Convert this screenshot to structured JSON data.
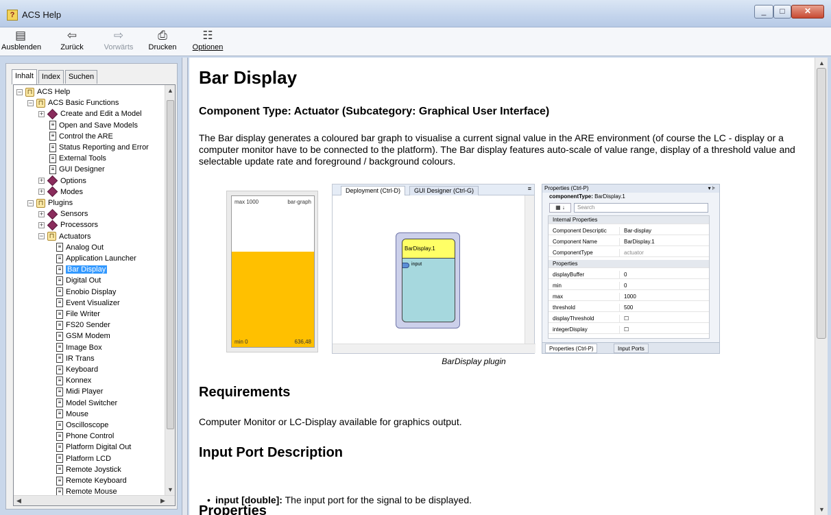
{
  "window": {
    "title": "ACS Help",
    "app_icon": "help-book-icon"
  },
  "toolbar": {
    "hide": "Ausblenden",
    "back": "Zurück",
    "forward": "Vorwärts",
    "print": "Drucken",
    "options": "Optionen"
  },
  "nav_tabs": [
    "Inhalt",
    "Index",
    "Suchen"
  ],
  "tree": [
    {
      "label": "ACS Help",
      "level": 0,
      "icon": "book",
      "expander": "−"
    },
    {
      "label": "ACS Basic Functions",
      "level": 1,
      "icon": "book",
      "expander": "−"
    },
    {
      "label": "Create and Edit a Model",
      "level": 2,
      "icon": "diamond",
      "expander": "+"
    },
    {
      "label": "Open and Save Models",
      "level": 3,
      "icon": "page"
    },
    {
      "label": "Control the ARE",
      "level": 3,
      "icon": "page"
    },
    {
      "label": "Status Reporting and Error",
      "level": 3,
      "icon": "page"
    },
    {
      "label": "External Tools",
      "level": 3,
      "icon": "page"
    },
    {
      "label": "GUI Designer",
      "level": 3,
      "icon": "page"
    },
    {
      "label": "Options",
      "level": 2,
      "icon": "diamond",
      "expander": "+"
    },
    {
      "label": "Modes",
      "level": 2,
      "icon": "diamond",
      "expander": "+"
    },
    {
      "label": "Plugins",
      "level": 1,
      "icon": "book",
      "expander": "−"
    },
    {
      "label": "Sensors",
      "level": 2,
      "icon": "diamond",
      "expander": "+"
    },
    {
      "label": "Processors",
      "level": 2,
      "icon": "diamond",
      "expander": "+"
    },
    {
      "label": "Actuators",
      "level": 2,
      "icon": "book",
      "expander": "−"
    },
    {
      "label": "Analog Out",
      "level": 4,
      "icon": "page"
    },
    {
      "label": "Application Launcher",
      "level": 4,
      "icon": "page"
    },
    {
      "label": "Bar Display",
      "level": 4,
      "icon": "page",
      "selected": true
    },
    {
      "label": "Digital Out",
      "level": 4,
      "icon": "page"
    },
    {
      "label": "Enobio Display",
      "level": 4,
      "icon": "page"
    },
    {
      "label": "Event Visualizer",
      "level": 4,
      "icon": "page"
    },
    {
      "label": "File Writer",
      "level": 4,
      "icon": "page"
    },
    {
      "label": "FS20 Sender",
      "level": 4,
      "icon": "page"
    },
    {
      "label": "GSM Modem",
      "level": 4,
      "icon": "page"
    },
    {
      "label": "Image Box",
      "level": 4,
      "icon": "page"
    },
    {
      "label": "IR Trans",
      "level": 4,
      "icon": "page"
    },
    {
      "label": "Keyboard",
      "level": 4,
      "icon": "page"
    },
    {
      "label": "Konnex",
      "level": 4,
      "icon": "page"
    },
    {
      "label": "Midi Player",
      "level": 4,
      "icon": "page"
    },
    {
      "label": "Model Switcher",
      "level": 4,
      "icon": "page"
    },
    {
      "label": "Mouse",
      "level": 4,
      "icon": "page"
    },
    {
      "label": "Oscilloscope",
      "level": 4,
      "icon": "page"
    },
    {
      "label": "Phone Control",
      "level": 4,
      "icon": "page"
    },
    {
      "label": "Platform Digital Out",
      "level": 4,
      "icon": "page"
    },
    {
      "label": "Platform LCD",
      "level": 4,
      "icon": "page"
    },
    {
      "label": "Remote Joystick",
      "level": 4,
      "icon": "page"
    },
    {
      "label": "Remote Keyboard",
      "level": 4,
      "icon": "page"
    },
    {
      "label": "Remote Mouse",
      "level": 4,
      "icon": "page"
    }
  ],
  "content": {
    "title": "Bar Display",
    "subtitle": "Component Type: Actuator (Subcategory: Graphical User Interface)",
    "description": "The Bar display generates a coloured bar graph to visualise a current signal value in the ARE environment (of course the LC - display or a computer monitor have to be connected to the platform). The Bar display features auto-scale of value range, display of a threshold value and selectable update rate and foreground / background colours.",
    "figure": {
      "bar": {
        "max_label": "max 1000",
        "name": "bar-graph",
        "min_label": "min 0",
        "value_label": "636,48",
        "fill_fraction": 0.63,
        "fill_color": "#ffc000"
      },
      "deployment_tabs": [
        "Deployment (Ctrl-D)",
        "GUI Designer (Ctrl-G)"
      ],
      "component_name": "BarDisplay.1",
      "port_label": "input",
      "props_title": "Properties (Ctrl-P)",
      "component_type_label": "componentType:",
      "component_type_value": "BarDisplay.1",
      "search_placeholder": "Search",
      "rows": [
        {
          "k": "Internal Properties",
          "v": "",
          "section": true
        },
        {
          "k": "Component Descriptic",
          "v": "Bar-display"
        },
        {
          "k": "Component Name",
          "v": "BarDisplay.1"
        },
        {
          "k": "ComponentType",
          "v": "actuator",
          "gray": true
        },
        {
          "k": "Properties",
          "v": "",
          "section": true
        },
        {
          "k": "displayBuffer",
          "v": "0"
        },
        {
          "k": "min",
          "v": "0"
        },
        {
          "k": "max",
          "v": "1000"
        },
        {
          "k": "threshold",
          "v": "500"
        },
        {
          "k": "displayThreshold",
          "v": "☐"
        },
        {
          "k": "integerDisplay",
          "v": "☐"
        }
      ],
      "bottom_tabs": [
        "Properties (Ctrl-P)",
        "Input Ports"
      ],
      "caption": "BarDisplay plugin"
    },
    "requirements_heading": "Requirements",
    "requirements_text": "Computer Monitor or LC-Display available for graphics output.",
    "input_heading": "Input Port Description",
    "input_port_name": "input [double]:",
    "input_port_desc": " The input port for the signal to be displayed.",
    "properties_heading": "Properties"
  }
}
